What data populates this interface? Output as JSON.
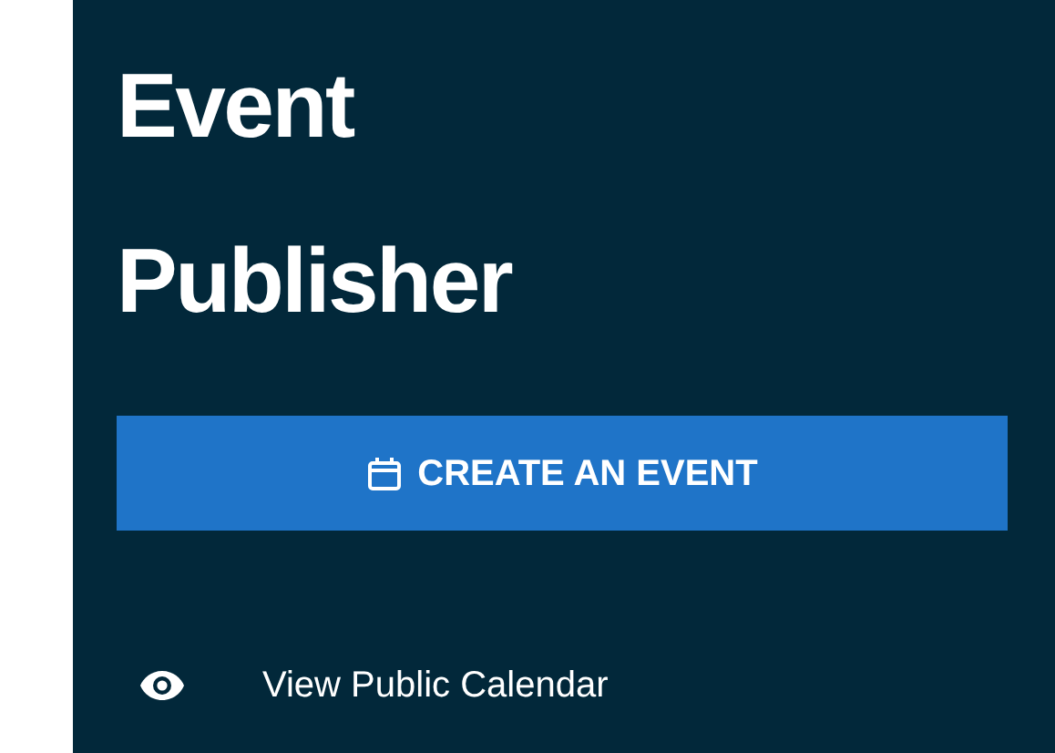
{
  "sidebar": {
    "title": "Event Publisher",
    "create_button": {
      "label": "CREATE AN EVENT"
    },
    "items": [
      {
        "label": "View Public Calendar",
        "kind": "eye"
      }
    ]
  }
}
